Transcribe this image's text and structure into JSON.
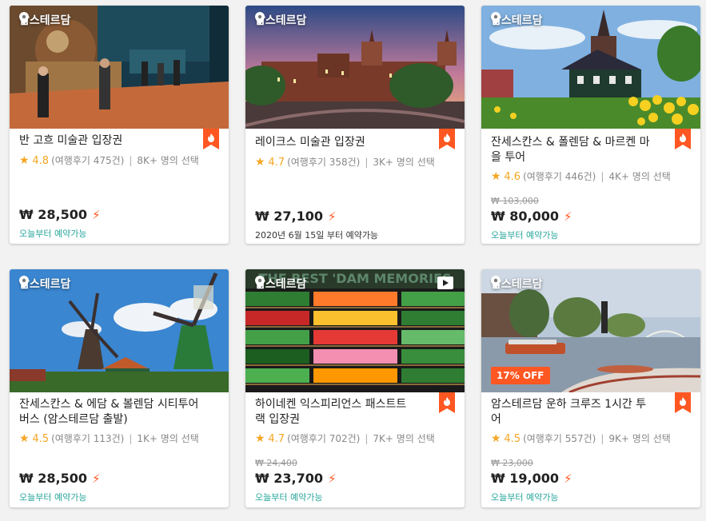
{
  "location_icon": "map-pin-icon",
  "hot_icon": "fire-badge-icon",
  "currency": "₩",
  "cards": [
    {
      "location": "암스테르담",
      "title": "반 고흐 미술관 입장권",
      "rating": "4.8",
      "reviews": "(여행후기 475건)",
      "chosen": "8K+ 명의 선택",
      "old_price": "",
      "price": "₩ 28,500",
      "availability": "오늘부터 예약가능"
    },
    {
      "location": "암스테르담",
      "title": "레이크스 미술관 입장권",
      "rating": "4.7",
      "reviews": "(여행후기 358건)",
      "chosen": "3K+ 명의 선택",
      "old_price": "",
      "price": "₩ 27,100",
      "availability": "2020년 6월 15일 부터 예약가능"
    },
    {
      "location": "암스테르담",
      "title": "잔세스칸스 & 폴렌담 & 마르켄 마을 투어",
      "rating": "4.6",
      "reviews": "(여행후기 446건)",
      "chosen": "4K+ 명의 선택",
      "old_price": "₩ 103,000",
      "price": "₩ 80,000",
      "availability": "오늘부터 예약가능"
    },
    {
      "location": "암스테르담",
      "title": "잔세스칸스 & 에담 & 볼렌담 시티투어 버스 (암스테르담 출발)",
      "rating": "4.5",
      "reviews": "(여행후기 113건)",
      "chosen": "1K+ 명의 선택",
      "old_price": "",
      "price": "₩ 28,500",
      "availability": "오늘부터 예약가능"
    },
    {
      "location": "암스테르담",
      "title": "하이네켄 익스피리언스 패스트트랙 입장권",
      "rating": "4.7",
      "reviews": "(여행후기 702건)",
      "chosen": "7K+ 명의 선택",
      "old_price": "₩ 24,400",
      "price": "₩ 23,700",
      "availability": "오늘부터 예약가능",
      "video_icon": "play-video-icon",
      "banner_text": "THE BEST 'DAM MEMORIES"
    },
    {
      "location": "암스테르담",
      "title": "암스테르담 운하 크루즈 1시간 투어",
      "rating": "4.5",
      "reviews": "(여행후기 557건)",
      "chosen": "9K+ 명의 선택",
      "old_price": "₩ 23,000",
      "price": "₩ 19,000",
      "availability": "오늘부터 예약가능",
      "discount": "17% OFF"
    }
  ],
  "colors": {
    "accent": "#ff5722",
    "star": "#f5a623",
    "availability": "#26a69a"
  }
}
